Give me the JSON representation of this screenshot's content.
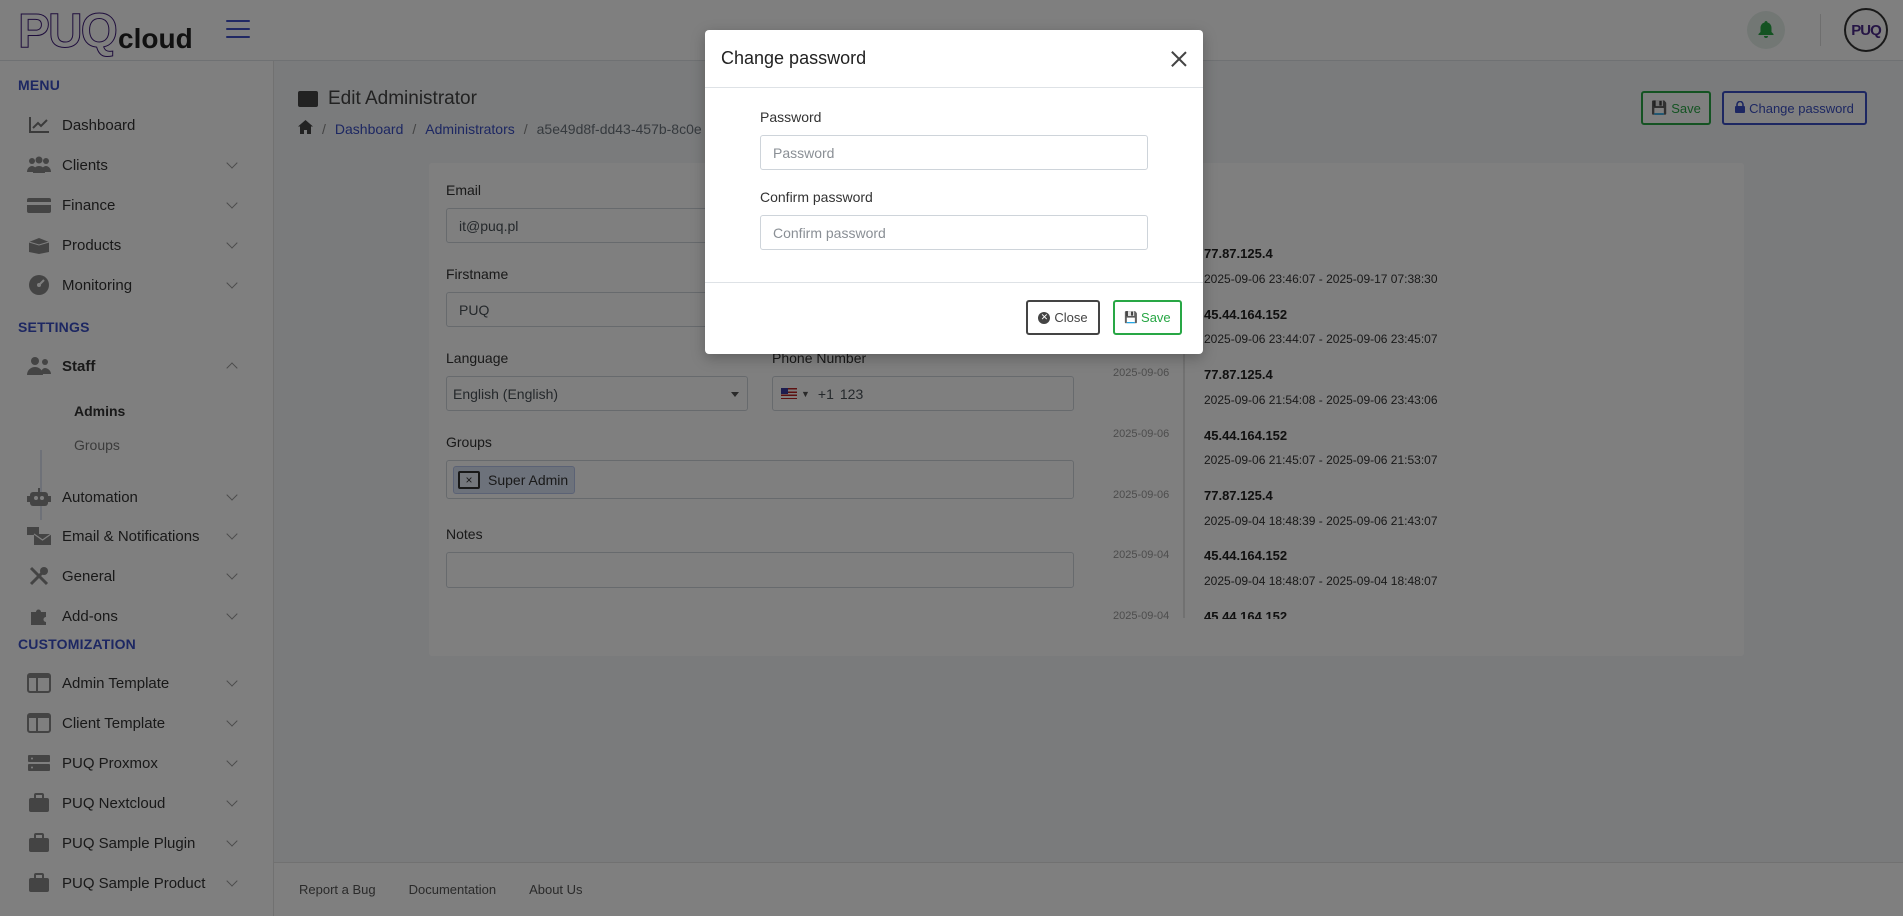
{
  "app": {
    "logo_main": "PUQ",
    "logo_sub": "cloud",
    "avatar_text": "PUQ"
  },
  "sidebar": {
    "menu_title": "MENU",
    "settings_title": "SETTINGS",
    "customization_title": "CUSTOMIZATION",
    "menu_items": [
      {
        "label": "Dashboard",
        "icon": "chart-line-icon"
      },
      {
        "label": "Clients",
        "icon": "users-icon"
      },
      {
        "label": "Finance",
        "icon": "credit-card-icon"
      },
      {
        "label": "Products",
        "icon": "box-open-icon"
      },
      {
        "label": "Monitoring",
        "icon": "gauge-icon"
      }
    ],
    "settings_items": [
      {
        "label": "Staff",
        "icon": "user-group-icon"
      },
      {
        "label": "Automation",
        "icon": "robot-icon"
      },
      {
        "label": "Email & Notifications",
        "icon": "mail-bulk-icon"
      },
      {
        "label": "General",
        "icon": "tools-icon"
      },
      {
        "label": "Add-ons",
        "icon": "puzzle-icon"
      }
    ],
    "staff_sub": [
      "Admins",
      "Groups"
    ],
    "customization_items": [
      {
        "label": "Admin Template",
        "icon": "layout-icon"
      },
      {
        "label": "Client Template",
        "icon": "layout-icon"
      },
      {
        "label": "PUQ Proxmox",
        "icon": "server-icon"
      },
      {
        "label": "PUQ Nextcloud",
        "icon": "briefcase-icon"
      },
      {
        "label": "PUQ Sample Plugin",
        "icon": "briefcase-icon"
      },
      {
        "label": "PUQ Sample Product",
        "icon": "briefcase-icon"
      }
    ]
  },
  "page": {
    "title": "Edit Administrator",
    "breadcrumb": [
      "Dashboard",
      "Administrators",
      "a5e49d8f-dd43-457b-8c0e"
    ],
    "save_label": "Save",
    "change_password_label": "Change password"
  },
  "form": {
    "email_label": "Email",
    "email_value": "it@puq.pl",
    "firstname_label": "Firstname",
    "firstname_value": "PUQ",
    "language_label": "Language",
    "language_value": "English (English)",
    "phone_label": "Phone Number",
    "phone_code": "+1",
    "phone_value": "123",
    "groups_label": "Groups",
    "group_tag": "Super Admin",
    "group_remove": "×",
    "notes_label": "Notes"
  },
  "sessions": {
    "dates": [
      "2025-09-06",
      "2025-09-06",
      "2025-09-06",
      "2025-09-04",
      "2025-09-04"
    ],
    "items": [
      {
        "ip": "77.87.125.4",
        "range": "2025-09-06 23:46:07 - 2025-09-17 07:38:30"
      },
      {
        "ip": "45.44.164.152",
        "range": "2025-09-06 23:44:07 - 2025-09-06 23:45:07"
      },
      {
        "ip": "77.87.125.4",
        "range": "2025-09-06 21:54:08 - 2025-09-06 23:43:06"
      },
      {
        "ip": "45.44.164.152",
        "range": "2025-09-06 21:45:07 - 2025-09-06 21:53:07"
      },
      {
        "ip": "77.87.125.4",
        "range": "2025-09-04 18:48:39 - 2025-09-06 21:43:07"
      },
      {
        "ip": "45.44.164.152",
        "range": "2025-09-04 18:48:07 - 2025-09-04 18:48:07"
      },
      {
        "ip": "45.44.164.152",
        "range": ""
      }
    ]
  },
  "footer": [
    "Report a Bug",
    "Documentation",
    "About Us"
  ],
  "modal": {
    "title": "Change password",
    "password_label": "Password",
    "password_placeholder": "Password",
    "confirm_label": "Confirm password",
    "confirm_placeholder": "Confirm password",
    "close_label": "Close",
    "save_label": "Save"
  },
  "colors": {
    "accent": "#3a4fc4",
    "success": "#28a745",
    "brand": "#3d1a78"
  }
}
